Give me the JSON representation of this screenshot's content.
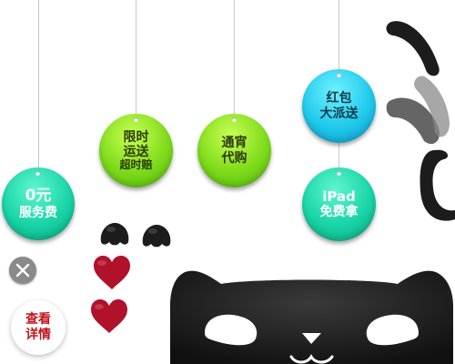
{
  "tags": {
    "free_service": {
      "line1": "0元",
      "line2": "服务费"
    },
    "limited_time": {
      "line1": "限时",
      "line2": "运送",
      "line3": "超时赔"
    },
    "overnight": {
      "line1": "通宵",
      "line2": "代购"
    },
    "red_packet": {
      "line1": "红包",
      "line2": "大派送"
    },
    "ipad": {
      "line1": "iPad",
      "line2": "免费拿"
    }
  },
  "controls": {
    "view_details_line1": "查看",
    "view_details_line2": "详情"
  },
  "colors": {
    "green_tag": "#7fdb1a",
    "teal_tag": "#18d4a6",
    "cyan_tag": "#20c9ec",
    "heart": "#b0112b",
    "cat": "#1c1c1c",
    "detail_text": "#c4141e"
  }
}
